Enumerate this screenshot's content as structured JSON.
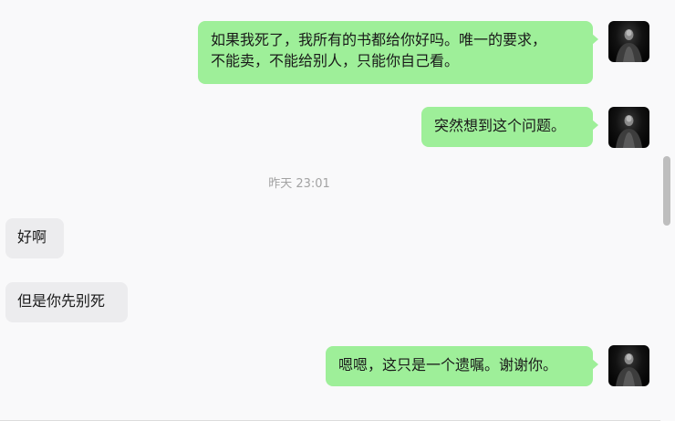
{
  "messages": [
    {
      "direction": "out",
      "text": "如果我死了，我所有的书都给你好吗。唯一的要求，\n不能卖，不能给别人，只能你自己看。"
    },
    {
      "direction": "out",
      "text": "突然想到这个问题。"
    },
    {
      "direction": "in",
      "text": "好啊"
    },
    {
      "direction": "in",
      "text": "但是你先别死"
    },
    {
      "direction": "out",
      "text": "嗯嗯，这只是一个遗嘱。谢谢你。"
    }
  ],
  "timestamp": "昨天 23:01",
  "colors": {
    "background": "#f9f9fa",
    "outgoing_bubble": "#9eef99",
    "incoming_bubble": "#ececee",
    "timestamp_text": "#a3a3a3"
  },
  "icons": {
    "sender_avatar": "avatar-photo-icon"
  }
}
